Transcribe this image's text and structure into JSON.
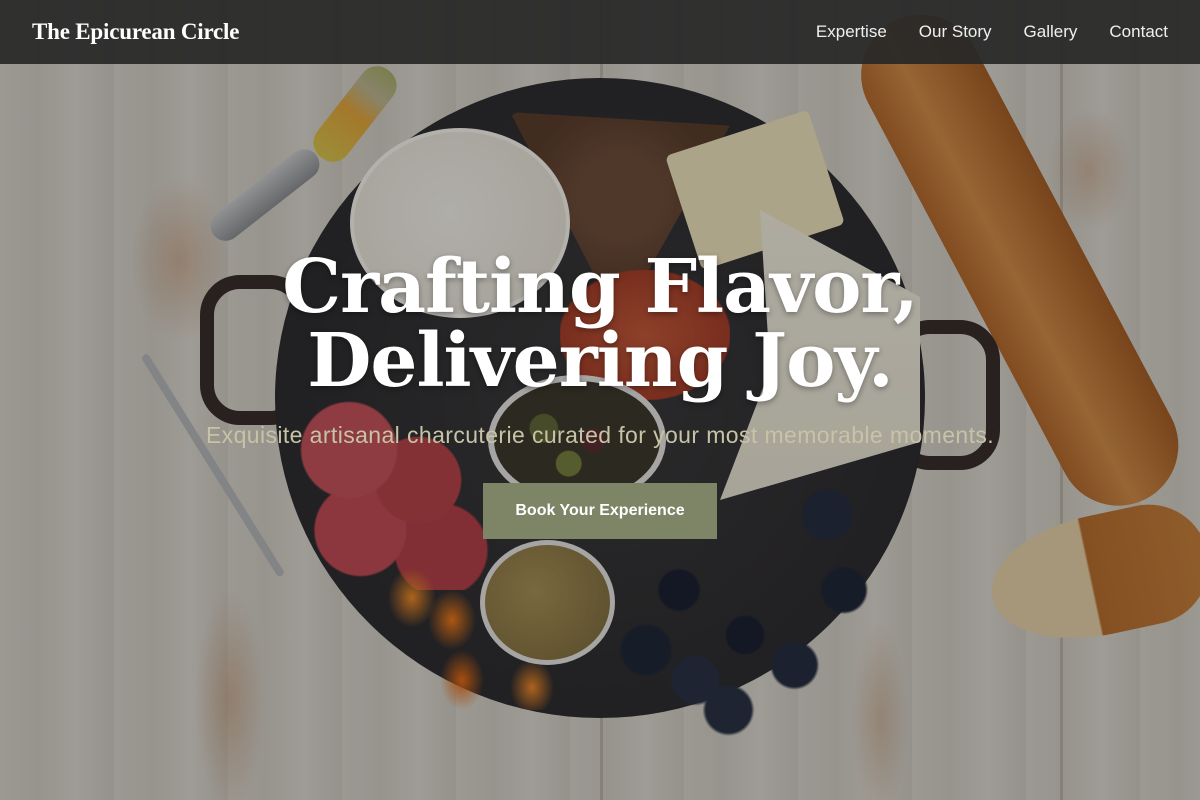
{
  "navbar": {
    "brand": "The Epicurean Circle",
    "links": [
      "Expertise",
      "Our Story",
      "Gallery",
      "Contact"
    ]
  },
  "hero": {
    "headline_line1": "Crafting Flavor,",
    "headline_line2": "Delivering Joy.",
    "subtitle": "Exquisite artisanal charcuterie curated for your most memorable moments.",
    "cta_label": "Book Your Experience",
    "background_image": "charcuterie-board-photo"
  },
  "colors": {
    "navbar_bg": "#282828",
    "cta_bg": "#7e8466",
    "subtitle_text": "#c7c3a6",
    "headline_text": "#ffffff"
  }
}
